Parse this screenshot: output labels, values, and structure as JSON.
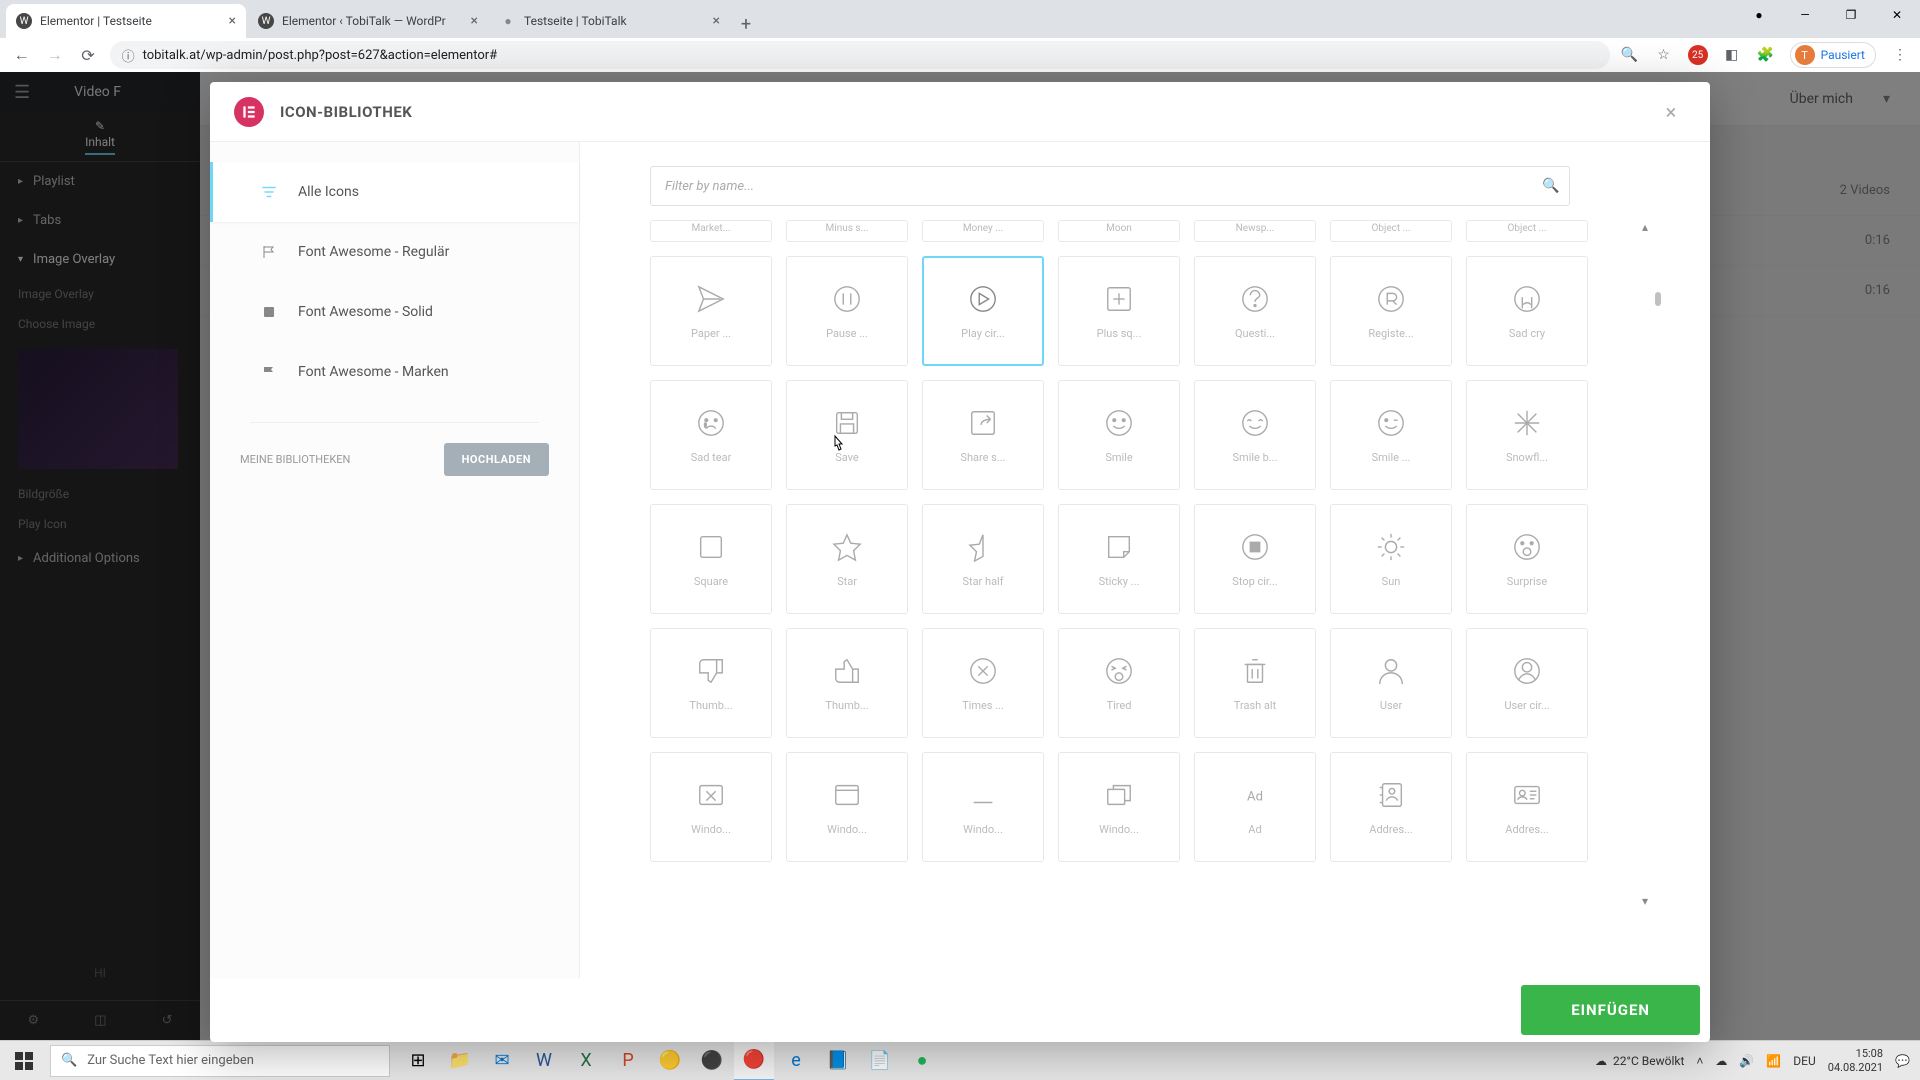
{
  "browser": {
    "tabs": [
      {
        "title": "Elementor | Testseite",
        "favicon": "W"
      },
      {
        "title": "Elementor ‹ TobiTalk — WordPr",
        "favicon": "W"
      },
      {
        "title": "Testseite | TobiTalk",
        "favicon": "●"
      }
    ],
    "url": "tobitalk.at/wp-admin/post.php?post=627&action=elementor#",
    "profile_status": "Pausiert",
    "profile_initial": "T"
  },
  "elementor_panel": {
    "title": "Video F",
    "tab_content": "Inhalt",
    "sections": [
      "Playlist",
      "Tabs",
      "Image Overlay",
      "Additional Options"
    ],
    "subitems": [
      "Image Overlay",
      "Choose Image",
      "Bildgröße",
      "Play Icon"
    ],
    "hint_label": "HI"
  },
  "main_header": {
    "ueber": "Über mich",
    "videos_count": "2 Videos",
    "durations": [
      "0:16",
      "0:16"
    ]
  },
  "modal": {
    "title": "ICON-BIBLIOTHEK",
    "search_placeholder": "Filter by name...",
    "sidebar": {
      "items": [
        {
          "label": "Alle Icons",
          "active": true
        },
        {
          "label": "Font Awesome - Regulär",
          "active": false
        },
        {
          "label": "Font Awesome - Solid",
          "active": false
        },
        {
          "label": "Font Awesome - Marken",
          "active": false
        }
      ],
      "upload_label": "MEINE BIBLIOTHEKEN",
      "upload_button": "HOCHLADEN"
    },
    "partial_row": [
      "Market...",
      "Minus s...",
      "Money ...",
      "Moon",
      "Newsp...",
      "Object ...",
      "Object ..."
    ],
    "icons": [
      {
        "name": "Paper ...",
        "svg": "paper-plane",
        "selected": false
      },
      {
        "name": "Pause ...",
        "svg": "pause-circle",
        "selected": false
      },
      {
        "name": "Play cir...",
        "svg": "play-circle",
        "selected": true
      },
      {
        "name": "Plus sq...",
        "svg": "plus-square",
        "selected": false
      },
      {
        "name": "Questi...",
        "svg": "question-circle",
        "selected": false
      },
      {
        "name": "Registe...",
        "svg": "registered",
        "selected": false
      },
      {
        "name": "Sad cry",
        "svg": "sad-cry",
        "selected": false
      },
      {
        "name": "Sad tear",
        "svg": "sad-tear",
        "selected": false
      },
      {
        "name": "Save",
        "svg": "save",
        "selected": false
      },
      {
        "name": "Share s...",
        "svg": "share-square",
        "selected": false
      },
      {
        "name": "Smile",
        "svg": "smile",
        "selected": false
      },
      {
        "name": "Smile b...",
        "svg": "smile-beam",
        "selected": false
      },
      {
        "name": "Smile ...",
        "svg": "smile-wink",
        "selected": false
      },
      {
        "name": "Snowfl...",
        "svg": "snowflake",
        "selected": false
      },
      {
        "name": "Square",
        "svg": "square",
        "selected": false
      },
      {
        "name": "Star",
        "svg": "star",
        "selected": false
      },
      {
        "name": "Star half",
        "svg": "star-half",
        "selected": false
      },
      {
        "name": "Sticky ...",
        "svg": "sticky-note",
        "selected": false
      },
      {
        "name": "Stop cir...",
        "svg": "stop-circle",
        "selected": false
      },
      {
        "name": "Sun",
        "svg": "sun",
        "selected": false
      },
      {
        "name": "Surprise",
        "svg": "surprise",
        "selected": false
      },
      {
        "name": "Thumb...",
        "svg": "thumbs-down",
        "selected": false
      },
      {
        "name": "Thumb...",
        "svg": "thumbs-up",
        "selected": false
      },
      {
        "name": "Times ...",
        "svg": "times-circle",
        "selected": false
      },
      {
        "name": "Tired",
        "svg": "tired",
        "selected": false
      },
      {
        "name": "Trash alt",
        "svg": "trash-alt",
        "selected": false
      },
      {
        "name": "User",
        "svg": "user",
        "selected": false
      },
      {
        "name": "User cir...",
        "svg": "user-circle",
        "selected": false
      },
      {
        "name": "Windo...",
        "svg": "window-close",
        "selected": false
      },
      {
        "name": "Windo...",
        "svg": "window-maximize",
        "selected": false
      },
      {
        "name": "Windo...",
        "svg": "window-minimize",
        "selected": false
      },
      {
        "name": "Windo...",
        "svg": "window-restore",
        "selected": false
      },
      {
        "name": "Ad",
        "svg": "ad",
        "selected": false
      },
      {
        "name": "Addres...",
        "svg": "address-book",
        "selected": false
      },
      {
        "name": "Addres...",
        "svg": "address-card",
        "selected": false
      }
    ],
    "insert_button": "EINFÜGEN"
  },
  "taskbar": {
    "search_placeholder": "Zur Suche Text hier eingeben",
    "weather": "22°C  Bewölkt",
    "lang": "DEU",
    "time": "15:08",
    "date": "04.08.2021"
  }
}
